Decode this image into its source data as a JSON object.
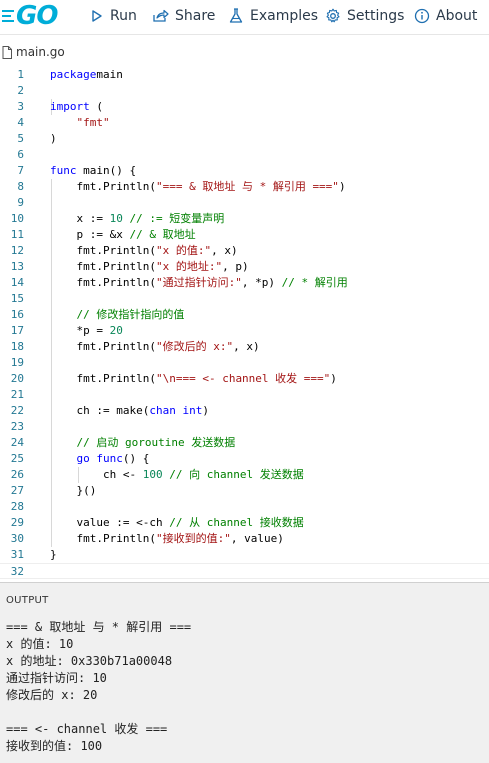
{
  "toolbar": {
    "logo": "GO",
    "run": "Run",
    "share": "Share",
    "examples": "Examples",
    "settings": "Settings",
    "about": "About"
  },
  "editor": {
    "filename": "main.go",
    "lines": [
      {
        "n": "1",
        "tokens": [
          [
            "k",
            "package"
          ],
          [
            "",
            "main"
          ]
        ]
      },
      {
        "n": "2",
        "tokens": []
      },
      {
        "n": "3",
        "tokens": [
          [
            "k",
            "import"
          ],
          [
            "",
            " ("
          ]
        ]
      },
      {
        "n": "4",
        "tokens": [
          [
            "",
            "    "
          ],
          [
            "s",
            "\"fmt\""
          ]
        ]
      },
      {
        "n": "5",
        "tokens": [
          [
            "",
            ")"
          ]
        ]
      },
      {
        "n": "6",
        "tokens": []
      },
      {
        "n": "7",
        "tokens": [
          [
            "k",
            "func"
          ],
          [
            "",
            " main() {"
          ]
        ]
      },
      {
        "n": "8",
        "tokens": [
          [
            "",
            "    fmt.Println("
          ],
          [
            "s",
            "\"=== & 取地址 与 * 解引用 ===\""
          ],
          [
            "",
            ")"
          ]
        ]
      },
      {
        "n": "9",
        "tokens": []
      },
      {
        "n": "10",
        "tokens": [
          [
            "",
            "    x := "
          ],
          [
            "n",
            "10"
          ],
          [
            "",
            " "
          ],
          [
            "c",
            "// := 短变量声明"
          ]
        ]
      },
      {
        "n": "11",
        "tokens": [
          [
            "",
            "    p := &x "
          ],
          [
            "c",
            "// & 取地址"
          ]
        ]
      },
      {
        "n": "12",
        "tokens": [
          [
            "",
            "    fmt.Println("
          ],
          [
            "s",
            "\"x 的值:\""
          ],
          [
            "",
            ", x)"
          ]
        ]
      },
      {
        "n": "13",
        "tokens": [
          [
            "",
            "    fmt.Println("
          ],
          [
            "s",
            "\"x 的地址:\""
          ],
          [
            "",
            ", p)"
          ]
        ]
      },
      {
        "n": "14",
        "tokens": [
          [
            "",
            "    fmt.Println("
          ],
          [
            "s",
            "\"通过指针访问:\""
          ],
          [
            "",
            ", *p) "
          ],
          [
            "c",
            "// * 解引用"
          ]
        ]
      },
      {
        "n": "15",
        "tokens": []
      },
      {
        "n": "16",
        "tokens": [
          [
            "",
            "    "
          ],
          [
            "c",
            "// 修改指针指向的值"
          ]
        ]
      },
      {
        "n": "17",
        "tokens": [
          [
            "",
            "    *p = "
          ],
          [
            "n",
            "20"
          ]
        ]
      },
      {
        "n": "18",
        "tokens": [
          [
            "",
            "    fmt.Println("
          ],
          [
            "s",
            "\"修改后的 x:\""
          ],
          [
            "",
            ", x)"
          ]
        ]
      },
      {
        "n": "19",
        "tokens": []
      },
      {
        "n": "20",
        "tokens": [
          [
            "",
            "    fmt.Println("
          ],
          [
            "s",
            "\"\\n=== <- channel 收发 ===\""
          ],
          [
            "",
            ")"
          ]
        ]
      },
      {
        "n": "21",
        "tokens": []
      },
      {
        "n": "22",
        "tokens": [
          [
            "",
            "    ch := make("
          ],
          [
            "k",
            "chan"
          ],
          [
            "",
            " "
          ],
          [
            "k",
            "int"
          ],
          [
            "",
            ")"
          ]
        ]
      },
      {
        "n": "23",
        "tokens": []
      },
      {
        "n": "24",
        "tokens": [
          [
            "",
            "    "
          ],
          [
            "c",
            "// 启动 goroutine 发送数据"
          ]
        ]
      },
      {
        "n": "25",
        "tokens": [
          [
            "",
            "    "
          ],
          [
            "k",
            "go"
          ],
          [
            "",
            " "
          ],
          [
            "k",
            "func"
          ],
          [
            "",
            "() {"
          ]
        ]
      },
      {
        "n": "26",
        "tokens": [
          [
            "",
            "        ch <- "
          ],
          [
            "n",
            "100"
          ],
          [
            "",
            " "
          ],
          [
            "c",
            "// 向 channel 发送数据"
          ]
        ]
      },
      {
        "n": "27",
        "tokens": [
          [
            "",
            "    }()"
          ]
        ]
      },
      {
        "n": "28",
        "tokens": []
      },
      {
        "n": "29",
        "tokens": [
          [
            "",
            "    value := <-ch "
          ],
          [
            "c",
            "// 从 channel 接收数据"
          ]
        ]
      },
      {
        "n": "30",
        "tokens": [
          [
            "",
            "    fmt.Println("
          ],
          [
            "s",
            "\"接收到的值:\""
          ],
          [
            "",
            ", value)"
          ]
        ]
      },
      {
        "n": "31",
        "tokens": [
          [
            "",
            "}"
          ]
        ]
      },
      {
        "n": "32",
        "tokens": []
      }
    ]
  },
  "output": {
    "label": "OUTPUT",
    "lines": [
      "=== & 取地址 与 * 解引用 ===",
      "x 的值: 10",
      "x 的地址: 0x330b71a00048",
      "通过指针访问: 10",
      "修改后的 x: 20",
      "",
      "=== <- channel 收发 ===",
      "接收到的值: 100"
    ]
  }
}
